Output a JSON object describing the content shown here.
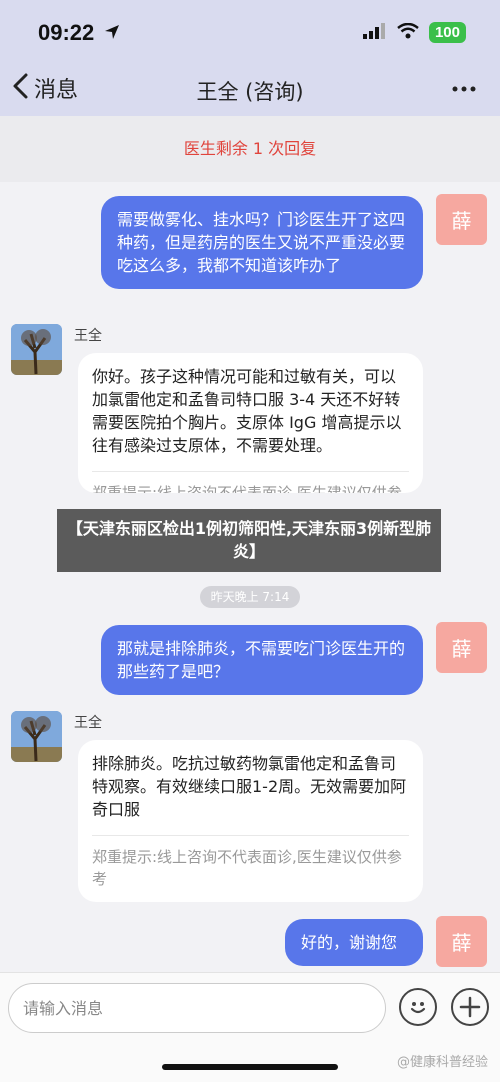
{
  "status_bar": {
    "time": "09:22",
    "battery": "100"
  },
  "nav": {
    "back_label": "消息",
    "title": "王全 (咨询)"
  },
  "notice": {
    "text": "医生剩余 1 次回复"
  },
  "messages": {
    "m1": {
      "text": "需要做雾化、挂水吗？门诊医生开了这四种药，但是药房的医生又说不严重没必要吃这么多，我都不知道该咋办了",
      "avatar": "薛"
    },
    "m2": {
      "name": "王全",
      "text": "你好。孩子这种情况可能和过敏有关，可以加氯雷他定和孟鲁司特口服 3-4 天还不好转需要医院拍个胸片。支原体 IgG 增高提示以往有感染过支原体，不需要处理。",
      "disclaimer": "郑重提示:线上咨询不代表面诊,医生建议仅供参考"
    },
    "time": "昨天晚上 7:14",
    "m3": {
      "text": "那就是排除肺炎，不需要吃门诊医生开的那些药了是吧？",
      "avatar": "薛"
    },
    "m4": {
      "name": "王全",
      "text": "排除肺炎。吃抗过敏药物氯雷他定和孟鲁司特观察。有效继续口服1-2周。无效需要加阿奇口服",
      "disclaimer": "郑重提示:线上咨询不代表面诊,医生建议仅供参考"
    },
    "m5": {
      "text": "好的，谢谢您",
      "avatar": "薛"
    }
  },
  "overlay": {
    "text": "【天津东丽区检出1例初筛阳性,天津东丽3例新型肺炎】"
  },
  "input": {
    "placeholder": "请输入消息"
  },
  "watermark": "@健康科普经验",
  "colors": {
    "outgoing_bubble": "#5876ea",
    "user_avatar": "#f6a8a0",
    "notice_text": "#e0443c"
  }
}
